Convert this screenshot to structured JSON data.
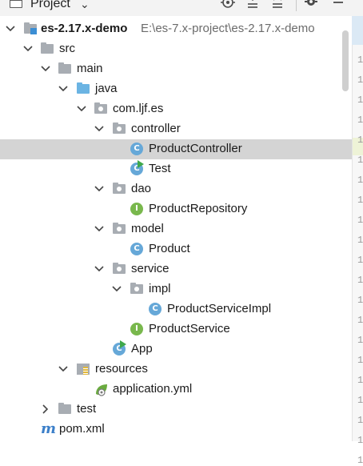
{
  "toolbar": {
    "title": "Project",
    "icons": [
      "window-icon",
      "dropdown-caret-icon",
      "locate-icon",
      "expand-all-icon",
      "collapse-all-icon",
      "gear-icon",
      "hide-icon"
    ]
  },
  "tree": {
    "project_name": "es-2.17.x-demo",
    "project_path": "E:\\es-7.x-project\\es-2.17.x-demo",
    "src": "src",
    "main": "main",
    "java": "java",
    "package": "com.ljf.es",
    "controller": "controller",
    "product_controller": "ProductController",
    "test_class": "Test",
    "dao": "dao",
    "product_repository": "ProductRepository",
    "model": "model",
    "product": "Product",
    "service": "service",
    "impl": "impl",
    "product_service_impl": "ProductServiceImpl",
    "product_service": "ProductService",
    "app": "App",
    "resources": "resources",
    "application_yml": "application.yml",
    "test_dir": "test",
    "pom": "pom.xml"
  },
  "class_badges": {
    "class": "C",
    "interface": "I"
  },
  "gutter": {
    "line_digits": [
      "1",
      "1",
      "1",
      "1",
      "1",
      "1",
      "1",
      "1",
      "1",
      "1",
      "1",
      "1",
      "1",
      "1",
      "1",
      "1",
      "1",
      "1",
      "1",
      "1",
      "1"
    ]
  },
  "colors": {
    "selection": "#d4d4d4",
    "class_icon": "#66a8d8",
    "interface_icon": "#79b84d",
    "folder": "#a8adb3",
    "source_folder": "#6bb4e3"
  }
}
